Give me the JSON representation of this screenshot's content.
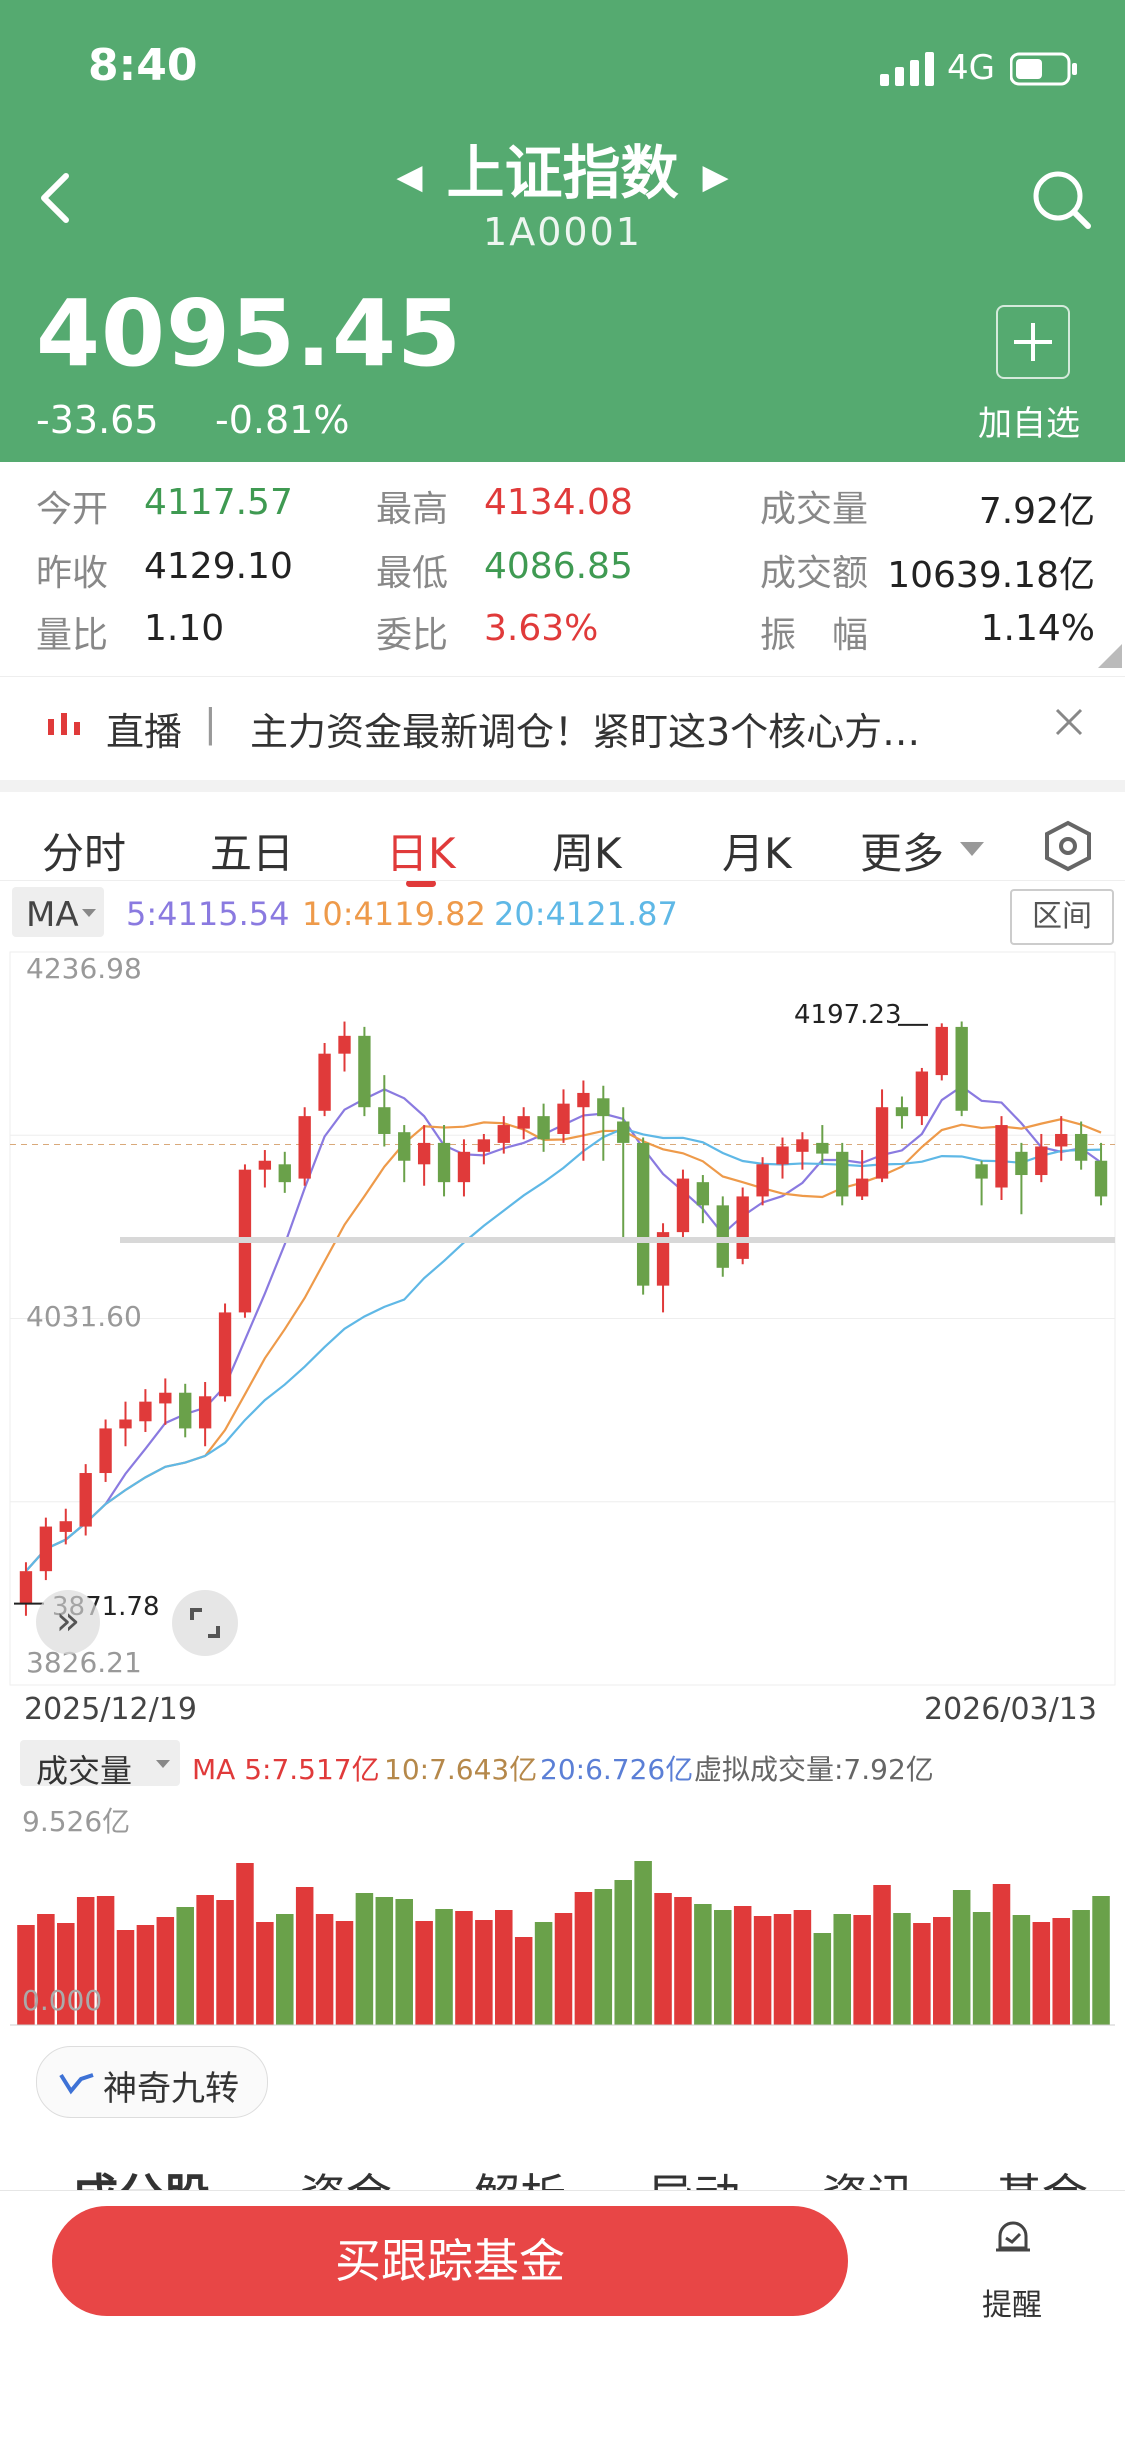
{
  "status": {
    "time": "8:40",
    "network": "4G"
  },
  "header": {
    "title": "上证指数",
    "code": "1A0001",
    "price": "4095.45",
    "change": "-33.65",
    "change_pct": "-0.81%",
    "add_watch": "加自选"
  },
  "stats": [
    {
      "label": "今开",
      "value": "4117.57",
      "color": "green"
    },
    {
      "label": "最高",
      "value": "4134.08",
      "color": "red"
    },
    {
      "label": "成交量",
      "value": "7.92亿",
      "color": "dark"
    },
    {
      "label": "昨收",
      "value": "4129.10",
      "color": "dark"
    },
    {
      "label": "最低",
      "value": "4086.85",
      "color": "green"
    },
    {
      "label": "成交额",
      "value": "10639.18亿",
      "color": "dark"
    },
    {
      "label": "量比",
      "value": "1.10",
      "color": "dark"
    },
    {
      "label": "委比",
      "value": "3.63%",
      "color": "red"
    },
    {
      "label": "振　幅",
      "value": "1.14%",
      "color": "dark"
    }
  ],
  "live": {
    "tag": "直播",
    "text": "主力资金最新调仓！紧盯这3个核心方…"
  },
  "tabs": [
    "分时",
    "五日",
    "日K",
    "周K",
    "月K",
    "更多"
  ],
  "active_tab": "日K",
  "ma": {
    "label": "MA",
    "ma5": "5:4115.54",
    "ma10": "10:4119.82",
    "ma20": "20:4121.87",
    "range_btn": "区间"
  },
  "chart_labels": {
    "top": "4236.98",
    "mid": "4031.60",
    "bottom": "3826.21",
    "high_mark": "4197.23",
    "low_mark": "3871.78",
    "date_start": "2025/12/19",
    "date_end": "2026/03/13"
  },
  "volume": {
    "label": "成交量",
    "ma5": "MA 5:7.517亿",
    "ma10": "10:7.643亿",
    "ma20": "20:6.726亿",
    "virtual": "虚拟成交量:7.92亿",
    "top": "9.526亿",
    "zero": "0.000"
  },
  "nine_turn": "神奇九转",
  "bottom_tabs": [
    "成分股",
    "资金",
    "解析",
    "异动",
    "资讯",
    "基金"
  ],
  "footer": {
    "buy": "买跟踪基金",
    "remind": "提醒"
  },
  "colors": {
    "header": "#55aa70",
    "up": "#e03a3a",
    "down": "#6aa14a",
    "ma5": "#8a7ae0",
    "ma10": "#ee9a4a",
    "ma20": "#5fb8e6"
  },
  "chart_data": {
    "type": "candlestick",
    "ylim": [
      3826.21,
      4236.98
    ],
    "y_ticks": [
      4236.98,
      4031.6,
      3826.21
    ],
    "x_range": [
      "2025/12/19",
      "2026/03/13"
    ],
    "candles": [
      [
        3872,
        3890,
        3865,
        3895
      ],
      [
        3890,
        3915,
        3885,
        3920
      ],
      [
        3912,
        3918,
        3905,
        3925
      ],
      [
        3915,
        3945,
        3910,
        3950
      ],
      [
        3945,
        3970,
        3940,
        3975
      ],
      [
        3970,
        3975,
        3960,
        3985
      ],
      [
        3974,
        3985,
        3968,
        3992
      ],
      [
        3984,
        3990,
        3972,
        3998
      ],
      [
        3990,
        3970,
        3965,
        3995
      ],
      [
        3970,
        3988,
        3960,
        3996
      ],
      [
        3988,
        4035,
        3985,
        4040
      ],
      [
        4035,
        4115,
        4032,
        4118
      ],
      [
        4115,
        4120,
        4105,
        4126
      ],
      [
        4118,
        4108,
        4102,
        4125
      ],
      [
        4110,
        4145,
        4106,
        4150
      ],
      [
        4148,
        4180,
        4145,
        4186
      ],
      [
        4180,
        4190,
        4170,
        4198
      ],
      [
        4190,
        4150,
        4145,
        4195
      ],
      [
        4150,
        4135,
        4128,
        4168
      ],
      [
        4136,
        4120,
        4108,
        4140
      ],
      [
        4118,
        4130,
        4106,
        4140
      ],
      [
        4130,
        4108,
        4100,
        4140
      ],
      [
        4108,
        4125,
        4100,
        4132
      ],
      [
        4125,
        4132,
        4118,
        4135
      ],
      [
        4130,
        4140,
        4124,
        4145
      ],
      [
        4138,
        4145,
        4132,
        4150
      ],
      [
        4145,
        4132,
        4125,
        4152
      ],
      [
        4135,
        4152,
        4130,
        4160
      ],
      [
        4150,
        4158,
        4120,
        4165
      ],
      [
        4155,
        4145,
        4120,
        4162
      ],
      [
        4142,
        4130,
        4075,
        4150
      ],
      [
        4130,
        4050,
        4045,
        4133
      ],
      [
        4050,
        4080,
        4035,
        4085
      ],
      [
        4080,
        4110,
        4075,
        4115
      ],
      [
        4108,
        4095,
        4085,
        4112
      ],
      [
        4095,
        4060,
        4055,
        4100
      ],
      [
        4065,
        4100,
        4062,
        4105
      ],
      [
        4100,
        4118,
        4095,
        4122
      ],
      [
        4118,
        4128,
        4110,
        4133
      ],
      [
        4125,
        4132,
        4115,
        4136
      ],
      [
        4130,
        4124,
        4118,
        4140
      ],
      [
        4125,
        4100,
        4095,
        4130
      ],
      [
        4100,
        4110,
        4098,
        4126
      ],
      [
        4110,
        4150,
        4108,
        4160
      ],
      [
        4150,
        4145,
        4138,
        4156
      ],
      [
        4145,
        4170,
        4140,
        4172
      ],
      [
        4168,
        4195,
        4165,
        4197
      ],
      [
        4195,
        4148,
        4145,
        4198
      ],
      [
        4118,
        4110,
        4095,
        4120
      ],
      [
        4105,
        4140,
        4098,
        4145
      ],
      [
        4125,
        4112,
        4090,
        4130
      ],
      [
        4112,
        4128,
        4108,
        4135
      ],
      [
        4128,
        4135,
        4120,
        4145
      ],
      [
        4135,
        4120,
        4115,
        4142
      ],
      [
        4120,
        4100,
        4095,
        4130
      ]
    ]
  }
}
